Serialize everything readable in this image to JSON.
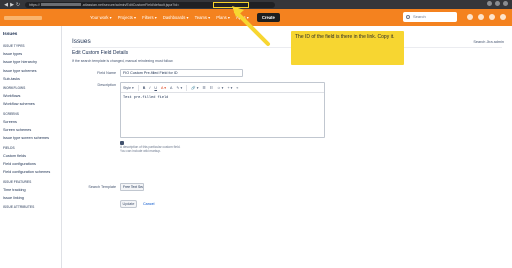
{
  "browser": {
    "url_prefix": "https://",
    "url_middle": ".atlassian.net/secure/admin/EditCustomField!default.jspa?id=",
    "back_glyph": "◀",
    "forward_glyph": "▶",
    "reload_glyph": "↻"
  },
  "topnav": {
    "items": [
      "Your work ▾",
      "Projects ▾",
      "Filters ▾",
      "Dashboards ▾",
      "Teams ▾",
      "Plans ▾",
      "Apps ▾"
    ],
    "create_label": "Create",
    "search_placeholder": "Search",
    "accent_color": "#f4821f"
  },
  "sidebar": {
    "title": "Issues",
    "sections": [
      {
        "heading": "ISSUE TYPES",
        "items": [
          "Issue types",
          "Issue type hierarchy",
          "Issue type schemes",
          "Sub-tasks"
        ]
      },
      {
        "heading": "WORKFLOWS",
        "items": [
          "Workflows",
          "Workflow schemes"
        ]
      },
      {
        "heading": "SCREENS",
        "items": [
          "Screens",
          "Screen schemes",
          "Issue type screen schemes"
        ]
      },
      {
        "heading": "FIELDS",
        "items": [
          "Custom fields",
          "Field configurations",
          "Field configuration schemes"
        ]
      },
      {
        "heading": "ISSUE FEATURES",
        "items": [
          "Time tracking",
          "Issue linking"
        ]
      },
      {
        "heading": "ISSUE ATTRIBUTES",
        "items": []
      }
    ]
  },
  "main": {
    "page_title": "Issues",
    "search_admin": "Search Jira admin",
    "form_title": "Edit Custom Field Details",
    "form_note": "If the search template is changed, manual reindexing must follow.",
    "field_name_label": "Field Name",
    "field_name_value": "FIO Custom Pre-filled Field for ID",
    "description_label": "Description",
    "toolbar": [
      "Style ▾",
      "B",
      "I",
      "U",
      "A ▾",
      "A",
      "✎ ▾",
      "🔗 ▾",
      "☰",
      "☷",
      "☺ ▾",
      "+ ▾",
      "«"
    ],
    "description_value": "Test pre-filled field",
    "desc_help_1": "A description of this particular custom field.",
    "desc_help_2": "You can include wiki markup.",
    "search_template_label": "Search Template",
    "search_template_value": "Free Text Searcher ▾",
    "update_label": "Update",
    "cancel_label": "Cancel"
  },
  "callout": {
    "text": "The ID of the field is there in the link. Copy it.",
    "color": "#f7d631"
  }
}
